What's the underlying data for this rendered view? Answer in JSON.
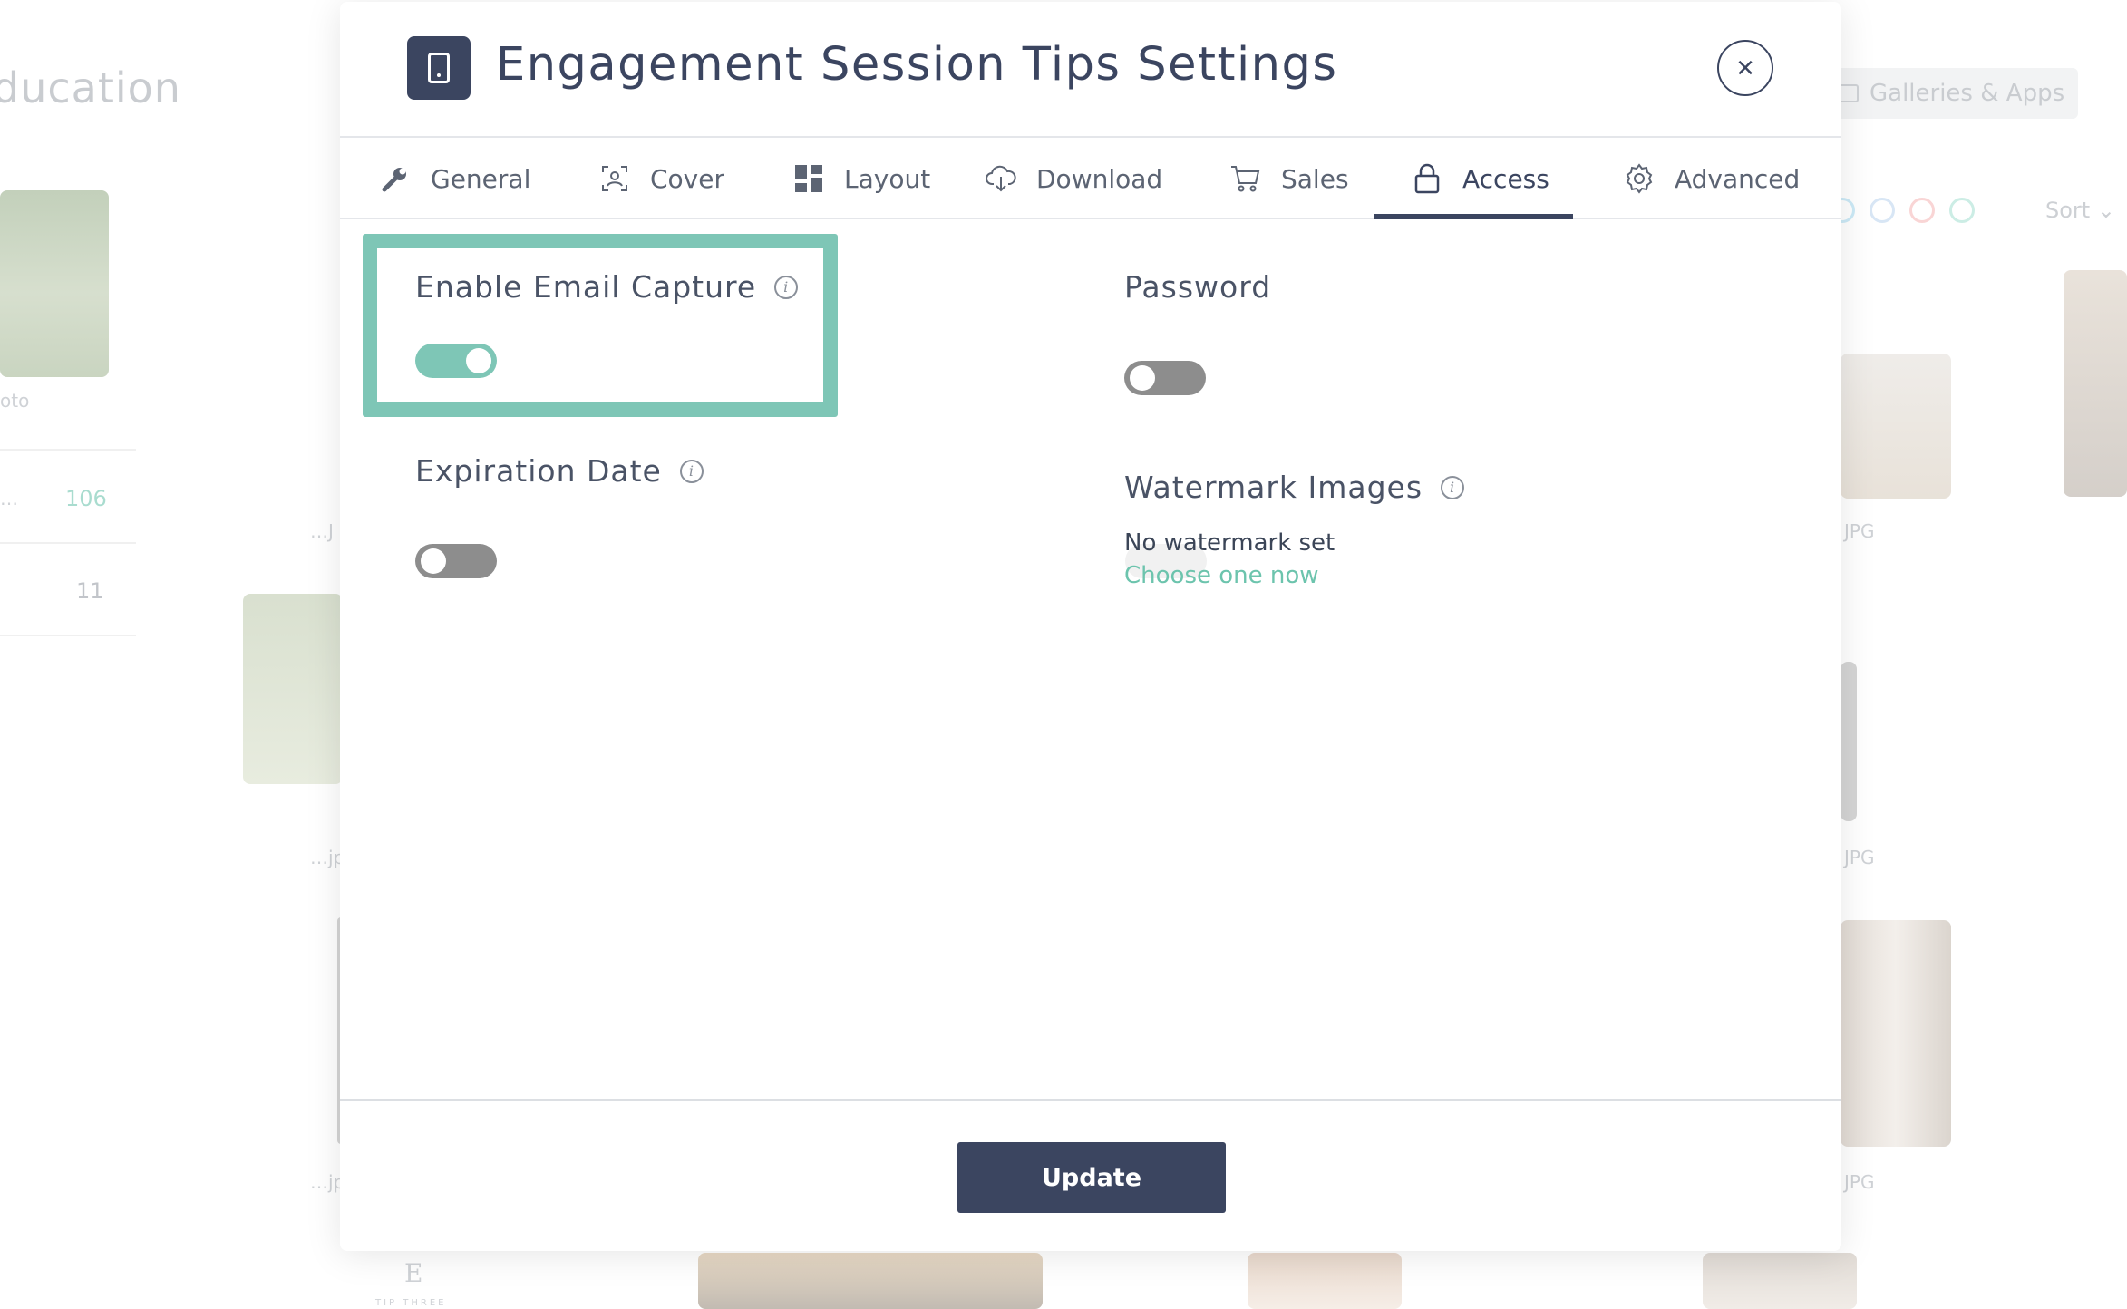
{
  "background": {
    "title_fragment": "ducation",
    "galleries_button": "Galleries & Apps",
    "sort_label": "Sort",
    "swatch_colors": [
      "#8fd0ee",
      "#a9c7e8",
      "#f2a1a1",
      "#8fd8c6"
    ],
    "captions": [
      "oto",
      "…",
      "…J",
      "…jp",
      "…jp",
      "JPG",
      "JPG",
      "JPG"
    ],
    "counts": [
      "106",
      "11"
    ],
    "thumb_text": [
      "E",
      "TIP THREE"
    ]
  },
  "modal": {
    "title": "Engagement Session Tips Settings",
    "close_glyph": "×"
  },
  "tabs": [
    {
      "label": "General",
      "icon": "wrench-icon"
    },
    {
      "label": "Cover",
      "icon": "cover-photo-icon"
    },
    {
      "label": "Layout",
      "icon": "grid-layout-icon"
    },
    {
      "label": "Download",
      "icon": "cloud-download-icon"
    },
    {
      "label": "Sales",
      "icon": "cart-icon"
    },
    {
      "label": "Access",
      "icon": "lock-icon",
      "active": true
    },
    {
      "label": "Advanced",
      "icon": "gear-icon"
    }
  ],
  "access": {
    "email_capture": {
      "label": "Enable Email Capture",
      "enabled": true
    },
    "password": {
      "label": "Password",
      "enabled": false
    },
    "expiration": {
      "label": "Expiration Date",
      "enabled": false
    },
    "watermark": {
      "label": "Watermark Images",
      "status": "No watermark set",
      "link": "Choose one now"
    }
  },
  "footer": {
    "update_label": "Update"
  },
  "colors": {
    "navy": "#3b4560",
    "accent_green": "#7ec6b6",
    "link_green": "#6cc4ad",
    "toggle_off": "#8d8d8d"
  }
}
